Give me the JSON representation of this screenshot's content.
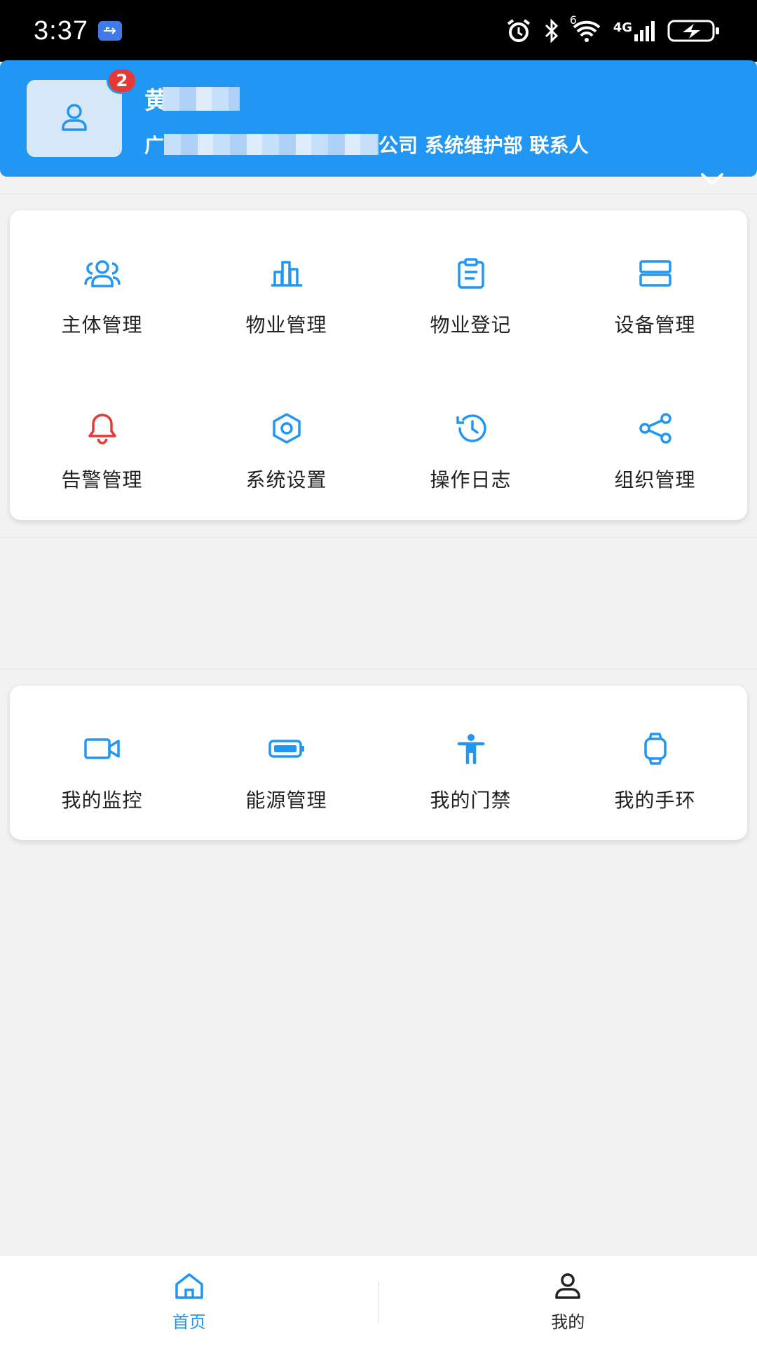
{
  "status_bar": {
    "time": "3:37",
    "icons": [
      "usb-icon",
      "alarm-icon",
      "bluetooth-icon",
      "wifi-icon",
      "signal-4g-icon",
      "battery-charging-icon"
    ],
    "network_label": "4G",
    "wifi_label": "6"
  },
  "header": {
    "name_visible": "黄",
    "org_prefix": "广",
    "org_suffix": "公司 系统维护部 联系人",
    "notification_count": "2",
    "accent_color": "#2196f3"
  },
  "main_menu": [
    {
      "label": "主体管理",
      "icon": "users-icon"
    },
    {
      "label": "物业管理",
      "icon": "building-chart-icon"
    },
    {
      "label": "物业登记",
      "icon": "clipboard-icon"
    },
    {
      "label": "设备管理",
      "icon": "server-icon"
    },
    {
      "label": "告警管理",
      "icon": "bell-icon"
    },
    {
      "label": "系统设置",
      "icon": "settings-hex-icon"
    },
    {
      "label": "操作日志",
      "icon": "history-icon"
    },
    {
      "label": "组织管理",
      "icon": "share-nodes-icon"
    }
  ],
  "personal_menu": [
    {
      "label": "我的监控",
      "icon": "video-camera-icon"
    },
    {
      "label": "能源管理",
      "icon": "battery-icon"
    },
    {
      "label": "我的门禁",
      "icon": "person-icon"
    },
    {
      "label": "我的手环",
      "icon": "watch-icon"
    }
  ],
  "bottom_nav": [
    {
      "label": "首页",
      "icon": "home-icon",
      "active": true
    },
    {
      "label": "我的",
      "icon": "user-icon",
      "active": false
    }
  ],
  "colors": {
    "primary": "#2196f3",
    "alert": "#e53935",
    "background": "#f2f2f2"
  }
}
